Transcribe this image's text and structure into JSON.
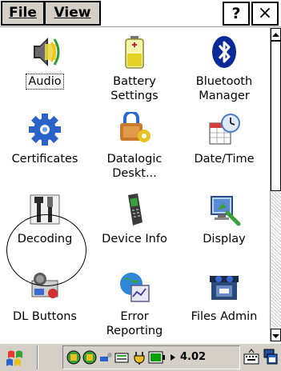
{
  "menubar": {
    "file_label": "File",
    "view_label": "View",
    "help_label": "?",
    "close_label": "×"
  },
  "items": [
    {
      "label": "Audio",
      "icon": "speaker-icon"
    },
    {
      "label": "Battery Settings",
      "label_line1": "Battery",
      "label_line2": "Settings",
      "icon": "battery-icon"
    },
    {
      "label": "Bluetooth Manager",
      "label_line1": "Bluetooth",
      "label_line2": "Manager",
      "icon": "bluetooth-icon"
    },
    {
      "label": "Certificates",
      "icon": "certificate-gear-icon"
    },
    {
      "label": "Datalogic Deskt...",
      "label_line1": "Datalogic",
      "label_line2": "Deskt...",
      "icon": "desktop-lock-icon"
    },
    {
      "label": "Date/Time",
      "icon": "clock-calendar-icon"
    },
    {
      "label": "Decoding",
      "icon": "tools-icon"
    },
    {
      "label": "Device Info",
      "icon": "handheld-scanner-icon"
    },
    {
      "label": "Display",
      "icon": "monitor-pointer-icon"
    },
    {
      "label": "DL Buttons",
      "icon": "buttons-icon"
    },
    {
      "label": "Error Reporting",
      "label_line1": "Error",
      "label_line2": "Reporting",
      "icon": "globe-graph-icon"
    },
    {
      "label": "Files Admin",
      "icon": "files-admin-icon"
    }
  ],
  "taskbar": {
    "battery_text": "4.02",
    "colors": {
      "bg": "#d4d0c8",
      "battery_green": "#00a000"
    }
  }
}
